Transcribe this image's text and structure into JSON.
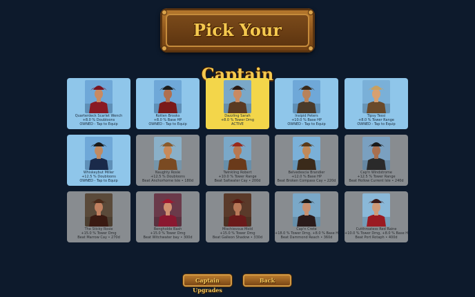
{
  "title": "Pick Your Captain",
  "buttons": {
    "upgrades": "Captain Upgrades",
    "back": "Back"
  },
  "cards": [
    {
      "name": "Quarterdeck Scarlet Wench",
      "bonus": "+8.0 % Doubloons",
      "status": "OWNED - Tap to Equip",
      "state": "owned",
      "skin": "#c98a62",
      "hat": "#7a1420",
      "coat": "#8a1a24",
      "bg": "#6fa8d8"
    },
    {
      "name": "Rotten Brooks",
      "bonus": "+8.0 % Base HP",
      "status": "OWNED - Tap to Equip",
      "state": "owned",
      "skin": "#b07050",
      "hat": "#1c1c1c",
      "coat": "#7a1a1a",
      "bg": "#6fa8d8"
    },
    {
      "name": "Dazzling Sarah",
      "bonus": "+8.0 % Tower Dmg",
      "status": "ACTIVE",
      "state": "active",
      "skin": "#c98a62",
      "hat": "#2a1a12",
      "coat": "#5a3a22",
      "bg": "#7aa8c8"
    },
    {
      "name": "Insipid Peters",
      "bonus": "+10.0 % Base HP",
      "status": "OWNED - Tap to Equip",
      "state": "owned",
      "skin": "#b8825a",
      "hat": "#3a2a1a",
      "coat": "#4a3a2a",
      "bg": "#6fa8d8"
    },
    {
      "name": "Tipsy Tessi",
      "bonus": "+8.0 % Tower Range",
      "status": "OWNED - Tap to Equip",
      "state": "owned",
      "skin": "#d8a070",
      "hat": "#c8a060",
      "coat": "#6a4a2a",
      "bg": "#7ab0d8"
    },
    {
      "name": "Whiskeybut Miller",
      "bonus": "+12.5 % Doubloons",
      "status": "OWNED - Tap to Equip",
      "state": "owned",
      "skin": "#c08a62",
      "hat": "#1a1a1a",
      "coat": "#1a2a4a",
      "bg": "#6fa8d8"
    },
    {
      "name": "Naughty Rosie",
      "bonus": "+12.5 % Doubloons",
      "status": "Beat Anchorhorne Isle • 180d",
      "state": "locked",
      "skin": "#c88a5a",
      "hat": "#8a5a2a",
      "coat": "#7a4a22",
      "bg": "#8ab0c8"
    },
    {
      "name": "Twinkling Robert",
      "bonus": "+10.0 % Tower Range",
      "status": "Beat Saltwater Cay • 200d",
      "state": "locked",
      "skin": "#b87850",
      "hat": "#9a2a1a",
      "coat": "#6a3a1a",
      "bg": "#7aa8c8"
    },
    {
      "name": "Belvedescia Brandier",
      "bonus": "+12.0 % Base HP",
      "status": "Beat Broken Compass Cay • 220d",
      "state": "locked",
      "skin": "#c08a5a",
      "hat": "#5a3a1a",
      "coat": "#3a2a1a",
      "bg": "#7ab0d8"
    },
    {
      "name": "Cap'n Windstrome",
      "bonus": "+12.5 % Tower Range",
      "status": "Beat Hollow Current Isle • 240d",
      "state": "locked",
      "skin": "#a87050",
      "hat": "#1a1a1a",
      "coat": "#2a2a2a",
      "bg": "#7aa0c0"
    },
    {
      "name": "The Sticky Rosie",
      "bonus": "+15.0 % Tower Dmg",
      "status": "Beat Marrow Cay • 270d",
      "state": "locked",
      "skin": "#c08060",
      "hat": "#4a2a1a",
      "coat": "#3a1a12",
      "bg": "#5a4a3a"
    },
    {
      "name": "Bengholde Bash",
      "bonus": "+15.0 % Tower Dmg",
      "status": "Beat Witchwater bay • 300d",
      "state": "locked",
      "skin": "#d09070",
      "hat": "#a01830",
      "coat": "#8a1830",
      "bg": "#6a3a4a"
    },
    {
      "name": "Mischievous Mold",
      "bonus": "+15.0 % Tower Dmg",
      "status": "Beat Galleon Shadow • 330d",
      "state": "locked",
      "skin": "#b87858",
      "hat": "#5a1a12",
      "coat": "#6a1a1a",
      "bg": "#5a3a2a"
    },
    {
      "name": "Cap'n Crete",
      "bonus": "+18.0 % Tower Dmg, +8.0 % Base HP",
      "status": "Beat Dammond Reach • 360d",
      "state": "locked",
      "skin": "#c89070",
      "hat": "#1a1a1a",
      "coat": "#2a1a1a",
      "bg": "#7aa8c8"
    },
    {
      "name": "Cutthroatess Red Raine",
      "bonus": "+10.0 % Tower Dmg, +8.0 % Base HP",
      "status": "Beat Port Rotaph • 400d",
      "state": "locked",
      "skin": "#d09a78",
      "hat": "#3a1a1a",
      "coat": "#9a1a22",
      "bg": "#8ab8d8"
    }
  ]
}
